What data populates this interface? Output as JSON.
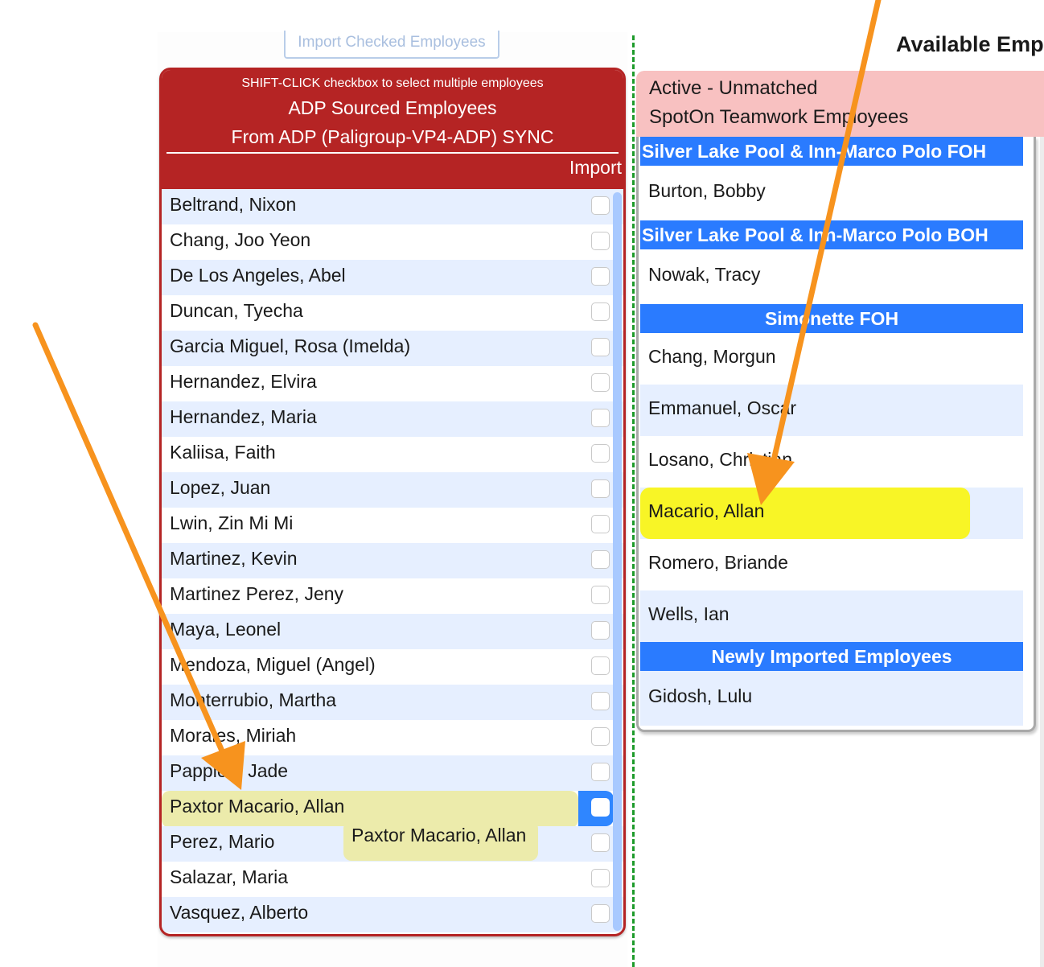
{
  "import_button": "Import Checked Employees",
  "adp": {
    "hint": "SHIFT-CLICK checkbox to select multiple employees",
    "title": "ADP Sourced Employees",
    "subtitle": "From ADP (Paligroup-VP4-ADP) SYNC",
    "import_col": "Import",
    "employees": [
      "Beltrand, Nixon",
      "Chang, Joo Yeon",
      "De Los Angeles, Abel",
      "Duncan, Tyecha",
      "Garcia Miguel, Rosa (Imelda)",
      "Hernandez, Elvira",
      "Hernandez, Maria",
      "Kaliisa, Faith",
      "Lopez, Juan",
      "Lwin, Zin Mi Mi",
      "Martinez, Kevin",
      "Martinez Perez, Jeny",
      "Maya, Leonel",
      "Mendoza, Miguel (Angel)",
      "Monterrubio, Martha",
      "Morales, Miriah",
      "Pappion, Jade",
      "Paxtor Macario, Allan",
      "Perez, Mario",
      "Salazar, Maria",
      "Vasquez, Alberto"
    ],
    "drag_ghost": "Paxtor Macario, Allan"
  },
  "available_title": "Available Emp",
  "spoton": {
    "line1": "Active - Unmatched",
    "line2": "SpotOn Teamwork Employees",
    "groups": [
      {
        "header": "Silver Lake Pool & Inn-Marco Polo FOH",
        "employees": [
          "Burton, Bobby"
        ]
      },
      {
        "header": "Silver Lake Pool & Inn-Marco Polo BOH",
        "employees": [
          "Nowak, Tracy"
        ]
      },
      {
        "header": "Simonette FOH",
        "employees": [
          "Chang, Morgun",
          "Emmanuel, Oscar",
          "Losano, Christian",
          "Macario, Allan",
          "Romero, Briande",
          "Wells, Ian"
        ]
      },
      {
        "header": "Newly Imported Employees",
        "employees": [
          "Gidosh, Lulu"
        ]
      }
    ]
  },
  "colors": {
    "adp_red": "#b52424",
    "group_blue": "#2a7bff",
    "row_blue": "#e6efff",
    "match_yellow": "#f8f526",
    "drag_yellow": "#ecebab",
    "arrow_orange": "#f7931e",
    "divider_green": "#1e9b2b"
  },
  "selected_index": 17,
  "highlight_match": "Macario, Allan"
}
